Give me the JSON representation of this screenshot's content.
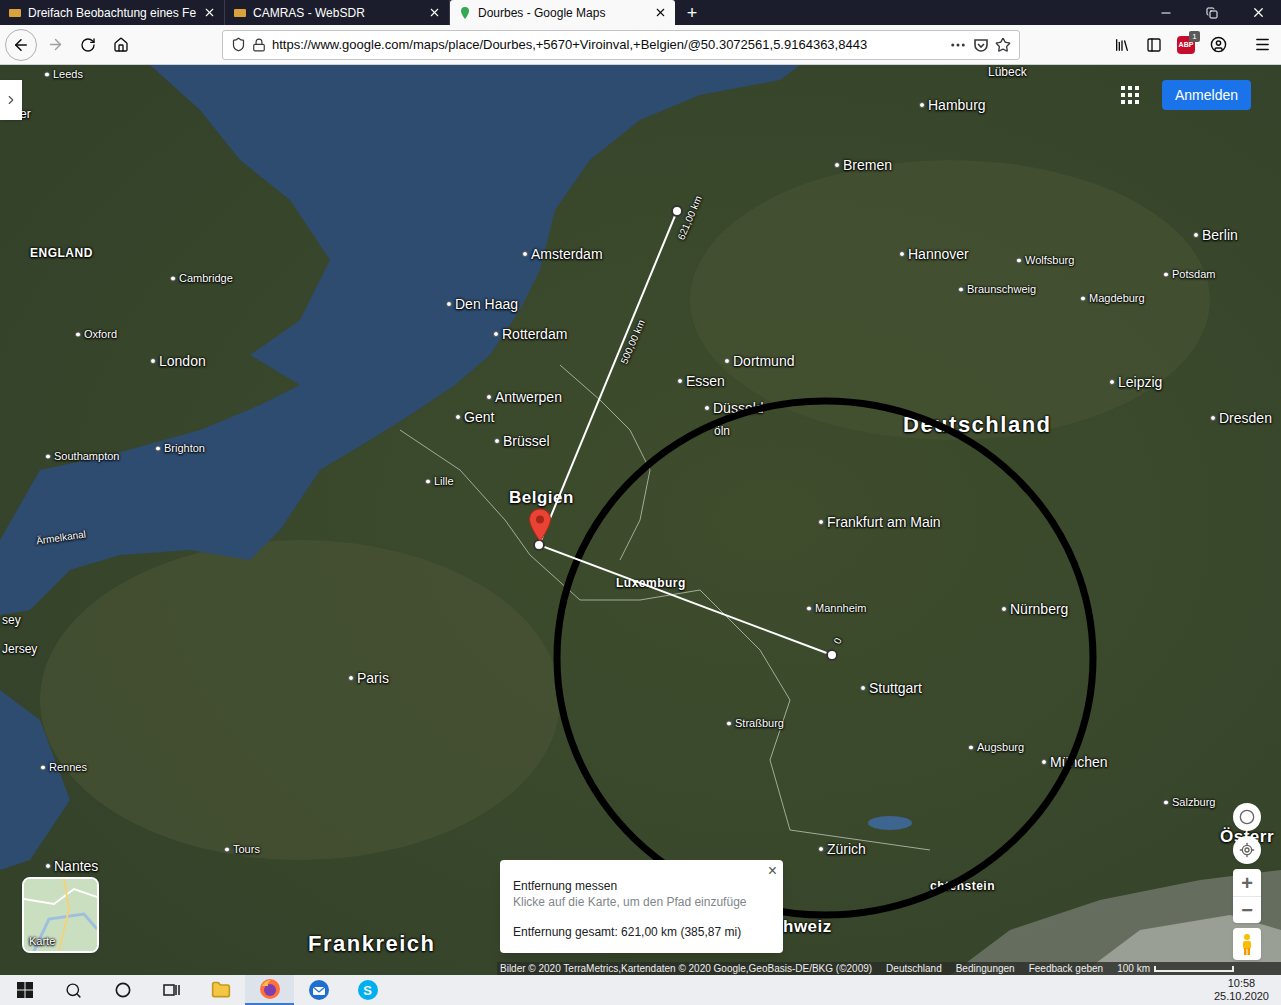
{
  "browser": {
    "tabs": [
      {
        "label": "Dreifach Beobachtung eines Fe",
        "selected": false
      },
      {
        "label": "CAMRAS - WebSDR",
        "selected": false
      },
      {
        "label": "Dourbes - Google Maps",
        "selected": true
      }
    ],
    "new_tab": "+",
    "url": "https://www.google.com/maps/place/Dourbes,+5670+Viroinval,+Belgien/@50.3072561,5.9164363,8443",
    "adblock": {
      "label": "ABP",
      "count": "1"
    }
  },
  "map": {
    "labels": [
      {
        "text": "Leeds",
        "kind": "city"
      },
      {
        "text": "ester",
        "kind": "fragment"
      },
      {
        "text": "ENGLAND",
        "kind": "small"
      },
      {
        "text": "Cambridge",
        "kind": "city"
      },
      {
        "text": "Oxford",
        "kind": "city"
      },
      {
        "text": "London",
        "kind": "capital"
      },
      {
        "text": "Brighton",
        "kind": "city"
      },
      {
        "text": "Southampton",
        "kind": "city"
      },
      {
        "text": "Ärmelkanal",
        "kind": "water"
      },
      {
        "text": "sey",
        "kind": "fragment"
      },
      {
        "text": "Jersey",
        "kind": "fragment"
      },
      {
        "text": "Rennes",
        "kind": "city"
      },
      {
        "text": "Tours",
        "kind": "city"
      },
      {
        "text": "Nantes",
        "kind": "capital"
      },
      {
        "text": "Paris",
        "kind": "capital"
      },
      {
        "text": "Lille",
        "kind": "city"
      },
      {
        "text": "Frankreich",
        "kind": "land"
      },
      {
        "text": "Amsterdam",
        "kind": "capital"
      },
      {
        "text": "Den Haag",
        "kind": "capital"
      },
      {
        "text": "Rotterdam",
        "kind": "capital"
      },
      {
        "text": "Antwerpen",
        "kind": "capital"
      },
      {
        "text": "Gent",
        "kind": "capital"
      },
      {
        "text": "Brüssel",
        "kind": "capital"
      },
      {
        "text": "Belgien",
        "kind": "country"
      },
      {
        "text": "Luxemburg",
        "kind": "small"
      },
      {
        "text": "Essen",
        "kind": "capital"
      },
      {
        "text": "Dortmund",
        "kind": "capital"
      },
      {
        "text": "Düsseld",
        "kind": "capital"
      },
      {
        "text": "öln",
        "kind": "fragment"
      },
      {
        "text": "Deutschland",
        "kind": "land"
      },
      {
        "text": "Frankfurt am Main",
        "kind": "capital"
      },
      {
        "text": "Mannheim",
        "kind": "city"
      },
      {
        "text": "Nürnberg",
        "kind": "capital"
      },
      {
        "text": "Stuttgart",
        "kind": "capital"
      },
      {
        "text": "Straßburg",
        "kind": "city"
      },
      {
        "text": "Augsburg",
        "kind": "city"
      },
      {
        "text": "München",
        "kind": "capital"
      },
      {
        "text": "Salzburg",
        "kind": "city"
      },
      {
        "text": "Zürich",
        "kind": "capital"
      },
      {
        "text": "chtenstein",
        "kind": "small"
      },
      {
        "text": "hweiz",
        "kind": "country"
      },
      {
        "text": "Österr",
        "kind": "country"
      },
      {
        "text": "Hamburg",
        "kind": "capital"
      },
      {
        "text": "Bremen",
        "kind": "capital"
      },
      {
        "text": "Hannover",
        "kind": "capital"
      },
      {
        "text": "Wolfsburg",
        "kind": "city"
      },
      {
        "text": "Braunschweig",
        "kind": "city"
      },
      {
        "text": "Magdeburg",
        "kind": "city"
      },
      {
        "text": "Berlin",
        "kind": "capital"
      },
      {
        "text": "Potsdam",
        "kind": "city"
      },
      {
        "text": "Leipzig",
        "kind": "capital"
      },
      {
        "text": "Dresden",
        "kind": "capital"
      },
      {
        "text": "Lübeck",
        "kind": "fragment"
      }
    ],
    "measure": {
      "labels": [
        "621,00 km",
        "500,00 km",
        "0"
      ]
    },
    "popup": {
      "title": "Entfernung messen",
      "hint": "Klicke auf die Karte, um den Pfad einzufüge",
      "total": "Entfernung gesamt: 621,00 km (385,87 mi)",
      "close": "×"
    },
    "sign_in": "Anmelden",
    "layer": "Karte",
    "zoom_in": "+",
    "zoom_out": "−",
    "attribution": [
      "Bilder © 2020 TerraMetrics,Kartendaten © 2020 Google,GeoBasis-DE/BKG (©2009)",
      "Deutschland",
      "Bedingungen",
      "Feedback geben"
    ],
    "scale": "100 km"
  },
  "taskbar": {
    "skype": "S",
    "time": "10:58",
    "date": "25.10.2020"
  }
}
